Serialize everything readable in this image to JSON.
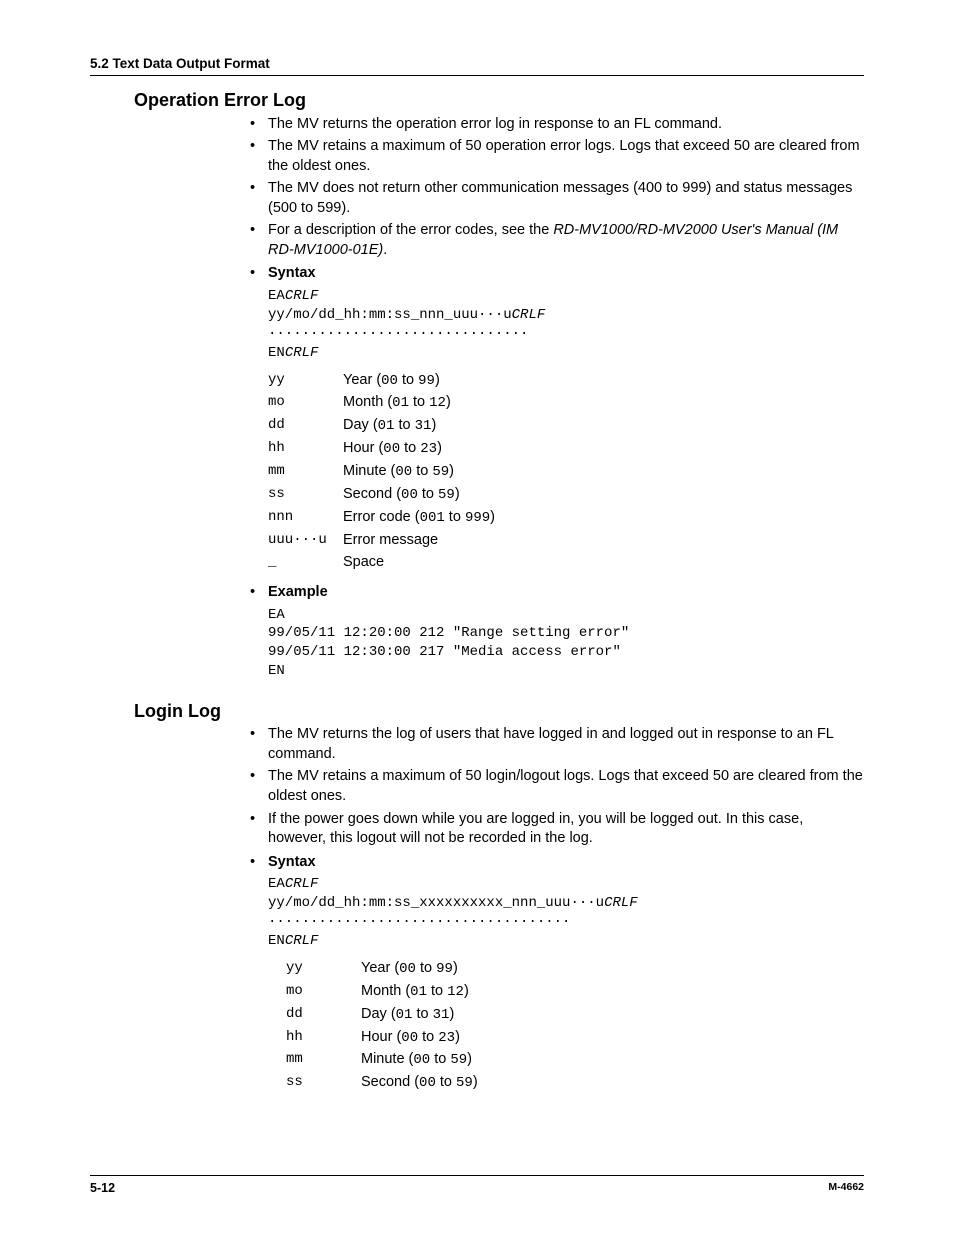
{
  "header": {
    "text": "5.2  Text Data Output Format"
  },
  "operr": {
    "title": "Operation Error Log",
    "bullets": [
      "The MV returns the operation error log in response to an FL command.",
      "The MV retains a maximum of 50 operation error logs. Logs that exceed 50 are cleared from the oldest ones.",
      "The MV does not return other communication messages (400 to 999) and status messages (500 to 599).",
      "For a description of the error codes, see the "
    ],
    "manual_ref": "RD-MV1000/RD-MV2000 User's Manual (IM RD-MV1000-01E)",
    "manual_period": ".",
    "syntax_label": "Syntax",
    "syntax": {
      "l1a": "EA",
      "l1b": "CRLF",
      "l2a": "yy/mo/dd_hh:mm:ss_nnn_uuu···u",
      "l2b": "CRLF",
      "l3": "·······························",
      "l4a": "EN",
      "l4b": "CRLF"
    },
    "params": [
      {
        "k": "yy",
        "label": "Year  (",
        "r": "00 to 99",
        "close": ")"
      },
      {
        "k": "mo",
        "label": "Month (",
        "r": "01 to 12",
        "close": ")"
      },
      {
        "k": "dd",
        "label": "Day (",
        "r": "01 to 31",
        "close": ")"
      },
      {
        "k": "hh",
        "label": "Hour (",
        "r": "00 to 23",
        "close": ")"
      },
      {
        "k": "mm",
        "label": "Minute (",
        "r": "00 to 59",
        "close": ")"
      },
      {
        "k": "ss",
        "label": "Second (",
        "r": "00 to 59",
        "close": ")"
      },
      {
        "k": "nnn",
        "label": "Error code (",
        "r": "001 to 999",
        "close": ")"
      },
      {
        "k": "uuu···u",
        "label": "Error message",
        "r": "",
        "close": ""
      },
      {
        "k": "_",
        "label": "Space",
        "r": "",
        "close": ""
      }
    ],
    "example_label": "Example",
    "example": [
      "EA",
      "99/05/11 12:20:00 212 \"Range setting error\"",
      "99/05/11 12:30:00 217 \"Media access error\"",
      "EN"
    ]
  },
  "login": {
    "title": "Login Log",
    "bullets": [
      "The MV returns the log of users that have logged in and logged out in response to an FL command.",
      "The MV retains a maximum of 50 login/logout logs. Logs that exceed 50 are cleared from the oldest ones.",
      "If the power goes down while you are logged in, you will be logged out. In this case, however, this logout will not be recorded in the log."
    ],
    "syntax_label": "Syntax",
    "syntax": {
      "l1a": "EA",
      "l1b": "CRLF",
      "l2a": "yy/mo/dd_hh:mm:ss_xxxxxxxxxx_nnn_uuu···u",
      "l2b": "CRLF",
      "l3": "····································",
      "l4a": "EN",
      "l4b": "CRLF"
    },
    "params": [
      {
        "k": "yy",
        "label": "Year (",
        "r": "00 to 99",
        "close": ")"
      },
      {
        "k": "mo",
        "label": "Month (",
        "r": "01 to 12",
        "close": ")"
      },
      {
        "k": "dd",
        "label": "Day (",
        "r": "01 to 31",
        "close": ")"
      },
      {
        "k": "hh",
        "label": "Hour (",
        "r": "00 to 23",
        "close": ")"
      },
      {
        "k": "mm",
        "label": "Minute (",
        "r": "00 to 59",
        "close": ")"
      },
      {
        "k": "ss",
        "label": "Second (",
        "r": "00 to 59",
        "close": ")"
      }
    ]
  },
  "footer": {
    "page": "5-12",
    "doc": "M-4662"
  }
}
